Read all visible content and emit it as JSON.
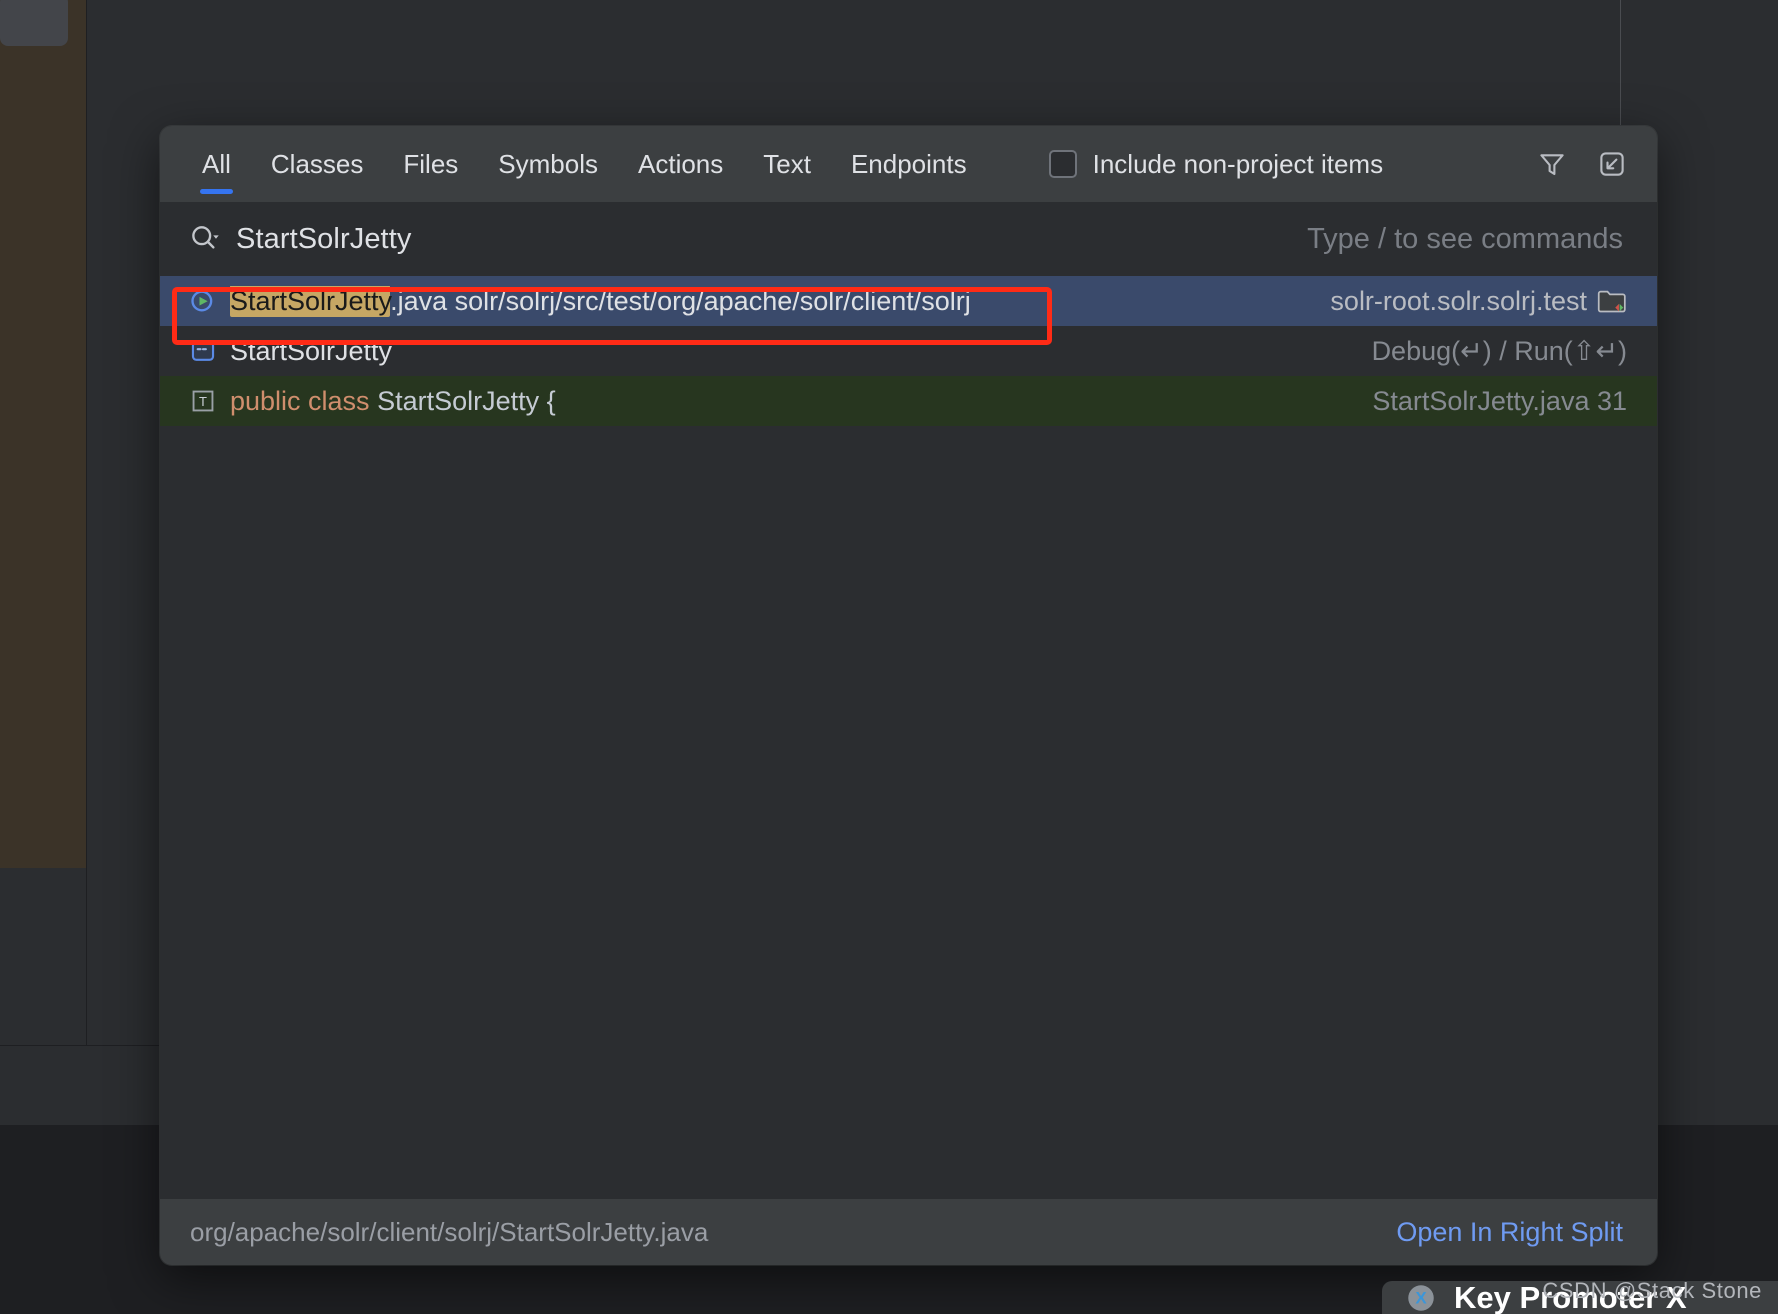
{
  "colors": {
    "accent_blue": "#3574f0",
    "selection_blue": "#3a4a6b",
    "code_hit_green": "#27361f",
    "match_highlight": "#c6a764",
    "annotation_red": "#ff2b16",
    "link_blue": "#6f9bf2",
    "popup_bg": "#2b2d30",
    "bar_bg": "#3c3f41"
  },
  "popup": {
    "tabs": [
      {
        "label": "All",
        "active": true
      },
      {
        "label": "Classes",
        "active": false
      },
      {
        "label": "Files",
        "active": false
      },
      {
        "label": "Symbols",
        "active": false
      },
      {
        "label": "Actions",
        "active": false
      },
      {
        "label": "Text",
        "active": false
      },
      {
        "label": "Endpoints",
        "active": false
      }
    ],
    "include_non_project": {
      "label": "Include non-project items",
      "checked": false
    },
    "toolbar_icons": [
      {
        "name": "filter-icon"
      },
      {
        "name": "open-in-find-tool-window-icon"
      }
    ],
    "search": {
      "value": "StartSolrJetty",
      "hint": "Type / to see commands",
      "icon": "search-dropdown-icon"
    },
    "results": [
      {
        "icon": "runnable-java-class-icon",
        "match_text": "StartSolrJetty",
        "rest_text": ".java  solr/solrj/src/test/org/apache/solr/client/solrj",
        "right_text": "solr-root.solr.solrj.test",
        "right_icon": "test-source-folder-icon",
        "state": "selected"
      },
      {
        "icon": "run-configuration-icon",
        "match_text": "",
        "rest_text": "StartSolrJetty",
        "right_text": "Debug(↵) / Run(⇧↵)",
        "right_icon": "",
        "state": "normal"
      },
      {
        "icon": "text-match-icon",
        "code_keyword": "public class",
        "code_rest": " StartSolrJetty {",
        "right_text": "StartSolrJetty.java  31",
        "right_icon": "",
        "state": "code-hit"
      }
    ],
    "footer": {
      "path": "org/apache/solr/client/solrj/StartSolrJetty.java",
      "action": "Open In Right Split"
    }
  },
  "key_promoter": {
    "title": "Key Promoter X",
    "icon": "key-promoter-x-icon"
  },
  "watermark": {
    "text": "CSDN @Stack Stone"
  }
}
